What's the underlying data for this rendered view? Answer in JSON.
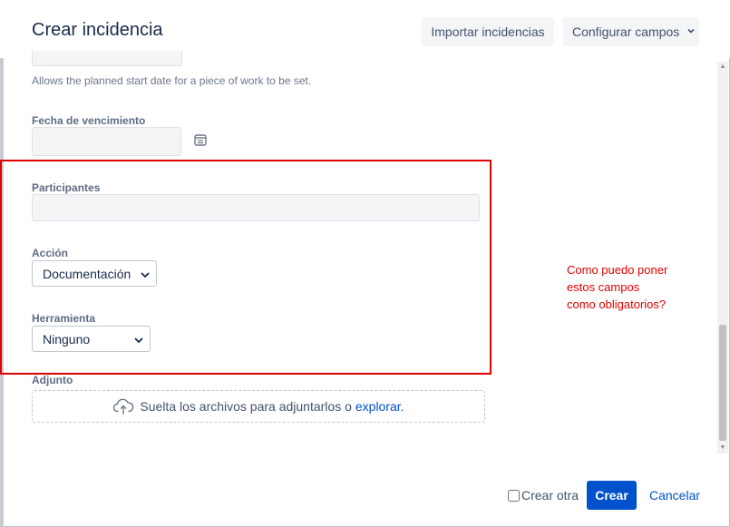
{
  "dialog": {
    "title": "Crear incidencia",
    "import_label": "Importar incidencias",
    "configure_label": "Configurar campos"
  },
  "fields": {
    "start_date_help": "Allows the planned start date for a piece of work to be set.",
    "due_date": {
      "label": "Fecha de vencimiento",
      "value": ""
    },
    "participants": {
      "label": "Participantes",
      "value": ""
    },
    "action": {
      "label": "Acción",
      "selected": "Documentación"
    },
    "tool": {
      "label": "Herramienta",
      "selected": "Ninguno"
    },
    "attachment": {
      "label": "Adjunto",
      "drop_text": "Suelta los archivos para adjuntarlos o",
      "browse_link": "explorar."
    }
  },
  "annotation": {
    "lines": [
      "Como puedo poner",
      "estos campos",
      "como obligatorios?"
    ],
    "color": "#e00000"
  },
  "footer": {
    "create_another_label": "Crear otra",
    "create_label": "Crear",
    "cancel_label": "Cancelar"
  },
  "colors": {
    "primary": "#0052cc",
    "highlight": "#e00000"
  },
  "icons": {
    "due_date": "calendar-icon",
    "dropzone": "cloud-upload-icon",
    "selects": "chevron-down-icon"
  }
}
